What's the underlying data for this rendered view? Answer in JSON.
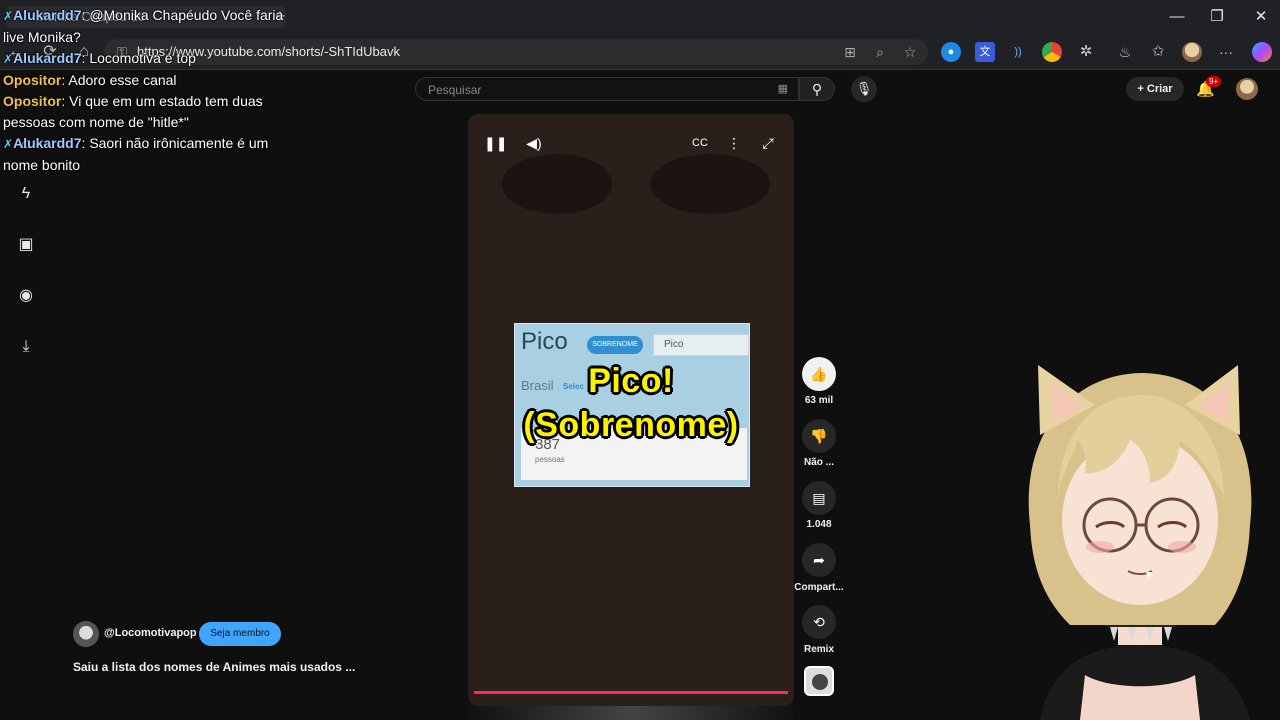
{
  "browser": {
    "tab_title": "Monika Chapéu do",
    "url": "https://www.youtube.com/shorts/-ShTIdUbavk",
    "window_controls": {
      "minimize": "—",
      "maximize": "❐",
      "close": "✕"
    }
  },
  "chat": [
    {
      "user": "Alukardd7",
      "user_color": "#9ec8ff",
      "badge": "sword-icon",
      "message": "@Monika Chapéudo Você faria live Monika?"
    },
    {
      "user": "Alukardd7",
      "user_color": "#9ec8ff",
      "badge": "sword-icon",
      "message": "Locomotiva é top"
    },
    {
      "user": "Opositor",
      "user_color": "#f2c14e",
      "badge": "",
      "message": "Adoro esse canal"
    },
    {
      "user": "Opositor",
      "user_color": "#f2c14e",
      "badge": "",
      "message": "Vi que em um estado tem duas pessoas com nome de \"hitle*\""
    },
    {
      "user": "Alukardd7",
      "user_color": "#9ec8ff",
      "badge": "sword-icon",
      "message": "Saori não irônicamente é um nome bonito"
    }
  ],
  "youtube": {
    "search_placeholder": "Pesquisar",
    "create_label": "Criar",
    "notification_count": "9+"
  },
  "video": {
    "card": {
      "name": "Pico",
      "pill": "SOBRENOME",
      "field": "Pico",
      "country": "Brasil",
      "select": "Selec",
      "count": "387",
      "people": "pessoas"
    },
    "caption_line1": "Pico!",
    "caption_line2": "(Sobrenome)",
    "progress_fraction": 1.0
  },
  "actions": {
    "like_count": "63 mil",
    "dislike_label": "Não ...",
    "comment_count": "1.048",
    "share_label": "Compart...",
    "remix_label": "Remix"
  },
  "channel": {
    "handle": "@Locomotivapop",
    "member_button": "Seja membro",
    "video_title": "Saiu a lista dos nomes de Animes mais usados ..."
  },
  "colors": {
    "accent": "#3ea6ff",
    "progress": "#ff2a57",
    "caption": "#fff200"
  }
}
